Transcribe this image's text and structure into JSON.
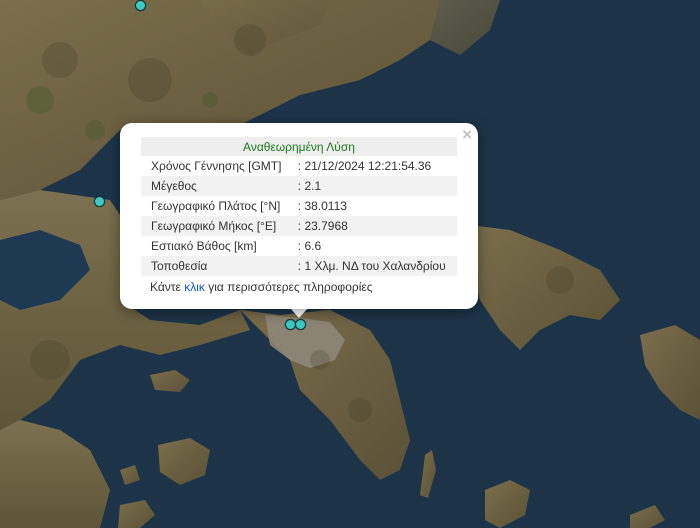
{
  "popup": {
    "title": "Αναθεωρημένη Λύση",
    "close_label": "×",
    "rows": [
      {
        "label": "Χρόνος Γέννησης [GMT]",
        "value": ": 21/12/2024 12:21:54.36"
      },
      {
        "label": "Μέγεθος",
        "value": ": 2.1"
      },
      {
        "label": "Γεωγραφικό Πλάτος [°N]",
        "value": ": 38.0113"
      },
      {
        "label": "Γεωγραφικό Μήκος [°E]",
        "value": ": 23.7968"
      },
      {
        "label": "Εστιακό Βάθος [km]",
        "value": ": 6.6"
      },
      {
        "label": "Τοποθεσία",
        "value": ": 1 Χλμ. ΝΔ του Χαλανδρίου"
      }
    ],
    "more_prefix": "Κάντε ",
    "more_link": "κλικ",
    "more_suffix": " για περισσότερες πληροφορίες"
  },
  "colors": {
    "sea": "#1c3347",
    "land": "#6e6445",
    "marker": "#3fc9c4",
    "title_green": "#1a7a1a",
    "link_blue": "#1a55c7"
  }
}
